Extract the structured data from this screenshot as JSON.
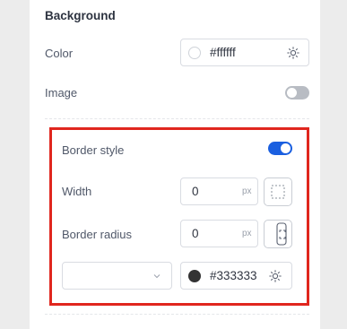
{
  "section": {
    "title": "Background"
  },
  "color_row": {
    "label": "Color",
    "value": "#ffffff",
    "swatch_color": "#ffffff",
    "icon": "sun-icon"
  },
  "image_row": {
    "label": "Image",
    "toggle_on": false
  },
  "border_style_row": {
    "label": "Border style",
    "toggle_on": true
  },
  "width_row": {
    "label": "Width",
    "value": "0",
    "unit": "px",
    "icon": "border-all-sides-icon"
  },
  "radius_row": {
    "label": "Border radius",
    "value": "0",
    "unit": "px",
    "icon": "radius-corners-icon"
  },
  "border_color_row": {
    "style_select_value": "",
    "value": "#333333",
    "swatch_color": "#333333",
    "icon": "sun-icon"
  },
  "colors": {
    "accent": "#1a5fe0",
    "highlight": "#e0261e",
    "toggle_off": "#b8bcc3"
  }
}
